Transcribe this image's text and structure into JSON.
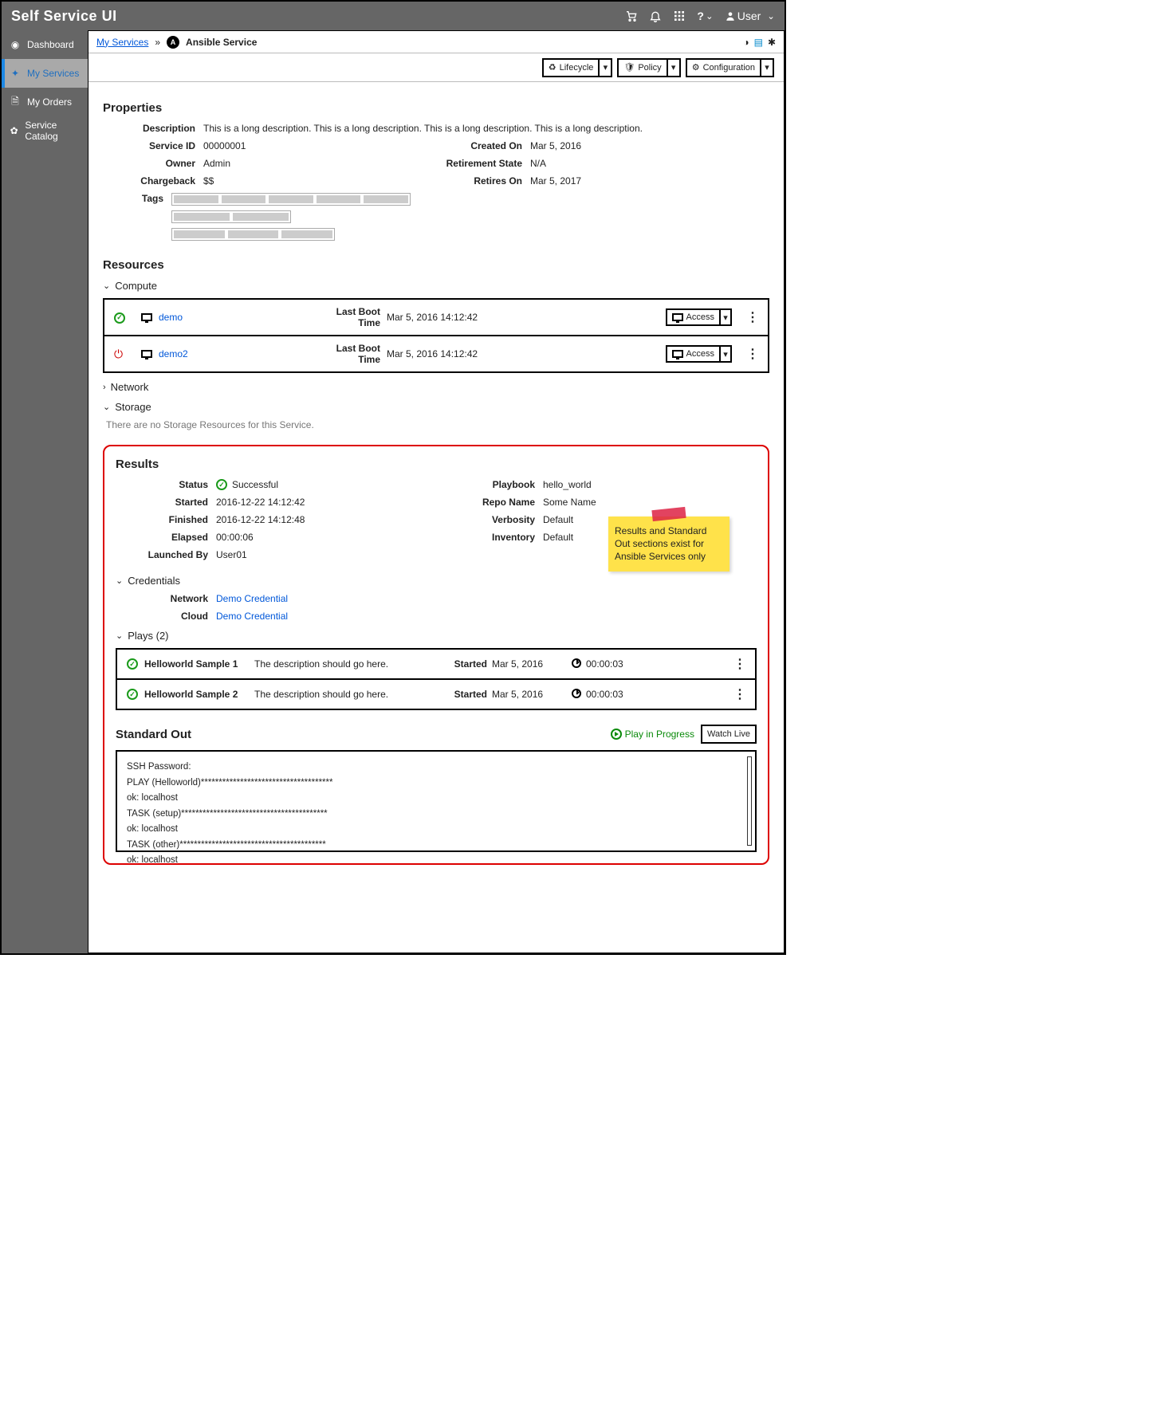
{
  "brand": "Self Service UI",
  "topbar": {
    "user_label": "User"
  },
  "sidebar": {
    "items": [
      {
        "label": "Dashboard"
      },
      {
        "label": "My Services"
      },
      {
        "label": "My Orders"
      },
      {
        "label": "Service Catalog"
      }
    ]
  },
  "breadcrumb": {
    "root": "My Services",
    "current": "Ansible Service"
  },
  "toolbar": {
    "lifecycle": "Lifecycle",
    "policy": "Policy",
    "configuration": "Configuration"
  },
  "properties": {
    "title": "Properties",
    "description_label": "Description",
    "description": "This is a long description. This is a long description. This is a long description. This is a long description.",
    "service_id_label": "Service ID",
    "service_id": "00000001",
    "owner_label": "Owner",
    "owner": "Admin",
    "chargeback_label": "Chargeback",
    "chargeback": "$$",
    "tags_label": "Tags",
    "created_on_label": "Created On",
    "created_on": "Mar 5, 2016",
    "retirement_state_label": "Retirement State",
    "retirement_state": "N/A",
    "retires_on_label": "Retires On",
    "retires_on": "Mar 5, 2017"
  },
  "resources": {
    "title": "Resources",
    "compute_label": "Compute",
    "last_boot_label": "Last Boot Time",
    "access_label": "Access",
    "items": [
      {
        "name": "demo",
        "status": "ok",
        "last_boot": "Mar 5, 2016  14:12:42"
      },
      {
        "name": "demo2",
        "status": "power",
        "last_boot": "Mar 5, 2016  14:12:42"
      }
    ],
    "network_label": "Network",
    "storage_label": "Storage",
    "storage_empty": "There are no Storage Resources for this Service."
  },
  "results": {
    "title": "Results",
    "status_label": "Status",
    "status": "Successful",
    "started_label": "Started",
    "started": "2016-12-22 14:12:42",
    "finished_label": "Finished",
    "finished": "2016-12-22 14:12:48",
    "elapsed_label": "Elapsed",
    "elapsed": "00:00:06",
    "launched_by_label": "Launched By",
    "launched_by": "User01",
    "playbook_label": "Playbook",
    "playbook": "hello_world",
    "repo_label": "Repo Name",
    "repo": "Some Name",
    "verbosity_label": "Verbosity",
    "verbosity": "Default",
    "inventory_label": "Inventory",
    "inventory": "Default"
  },
  "credentials": {
    "title": "Credentials",
    "network_label": "Network",
    "network": "Demo Credential",
    "cloud_label": "Cloud",
    "cloud": "Demo Credential"
  },
  "plays": {
    "title": "Plays (2)",
    "started_label": "Started",
    "items": [
      {
        "name": "Helloworld Sample 1",
        "desc": "The description should go here.",
        "started": "Mar 5, 2016",
        "elapsed": "00:00:03"
      },
      {
        "name": "Helloworld Sample 2",
        "desc": "The description should go here.",
        "started": "Mar 5, 2016",
        "elapsed": "00:00:03"
      }
    ]
  },
  "stdout": {
    "title": "Standard Out",
    "play_in_progress": "Play in Progress",
    "watch_live": "Watch Live",
    "lines": [
      "SSH Password:",
      "PLAY (Helloworld)*************************************",
      "ok: localhost",
      "TASK (setup)*****************************************",
      "ok: localhost",
      "TASK (other)*****************************************",
      "ok: localhost"
    ]
  },
  "annotation": "Results and Standard Out sections exist for Ansible Services only"
}
